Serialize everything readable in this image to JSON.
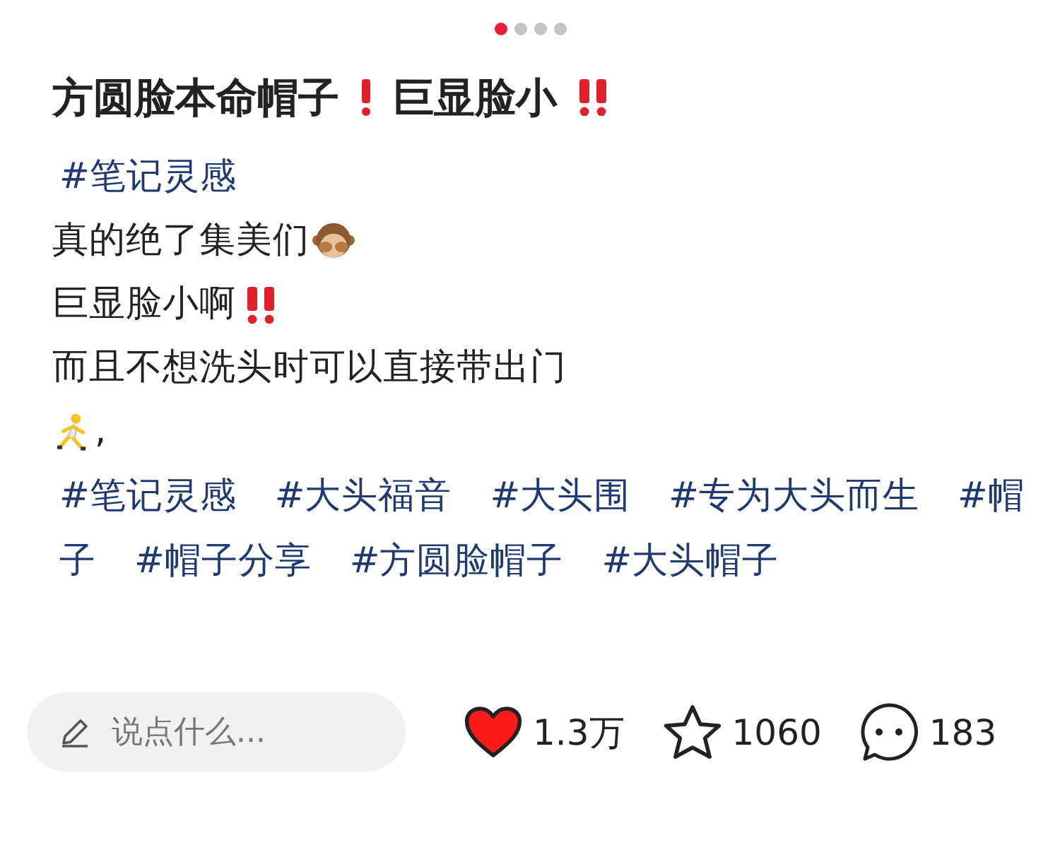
{
  "pager": [
    {
      "selected": true
    },
    {
      "selected": false
    },
    {
      "selected": false
    },
    {
      "selected": false
    }
  ],
  "title": [
    {
      "kind": "text",
      "text": "方圆脸本命帽子"
    },
    {
      "kind": "exclaim"
    },
    {
      "kind": "text",
      "text": "巨显脸小"
    },
    {
      "kind": "double-exclaim"
    }
  ],
  "lines": [
    [
      {
        "kind": "tag",
        "text": "#笔记灵感"
      }
    ],
    [
      {
        "kind": "text",
        "text": "真的绝了集美们"
      },
      {
        "kind": "monkey"
      }
    ],
    [
      {
        "kind": "text",
        "text": "巨显脸小啊"
      },
      {
        "kind": "double-exclaim"
      }
    ],
    [
      {
        "kind": "text",
        "text": "而且不想洗头时可以直接带出门"
      }
    ],
    [
      {
        "kind": "runner"
      },
      {
        "kind": "text",
        "text": ","
      }
    ]
  ],
  "tag_lines": [
    [
      "#笔记灵感",
      "#大头福音",
      "#大头围",
      "#专为大头而生",
      "#帽"
    ],
    [
      "子",
      "#帽子分享",
      "#方圆脸帽子",
      "#大头帽子"
    ]
  ],
  "comment_field": {
    "placeholder": "说点什么..."
  },
  "actions": [
    {
      "kind": "like",
      "count": "1.3万",
      "selected": true
    },
    {
      "kind": "collect",
      "count": "1060",
      "selected": false
    },
    {
      "kind": "comment",
      "count": "183"
    }
  ]
}
